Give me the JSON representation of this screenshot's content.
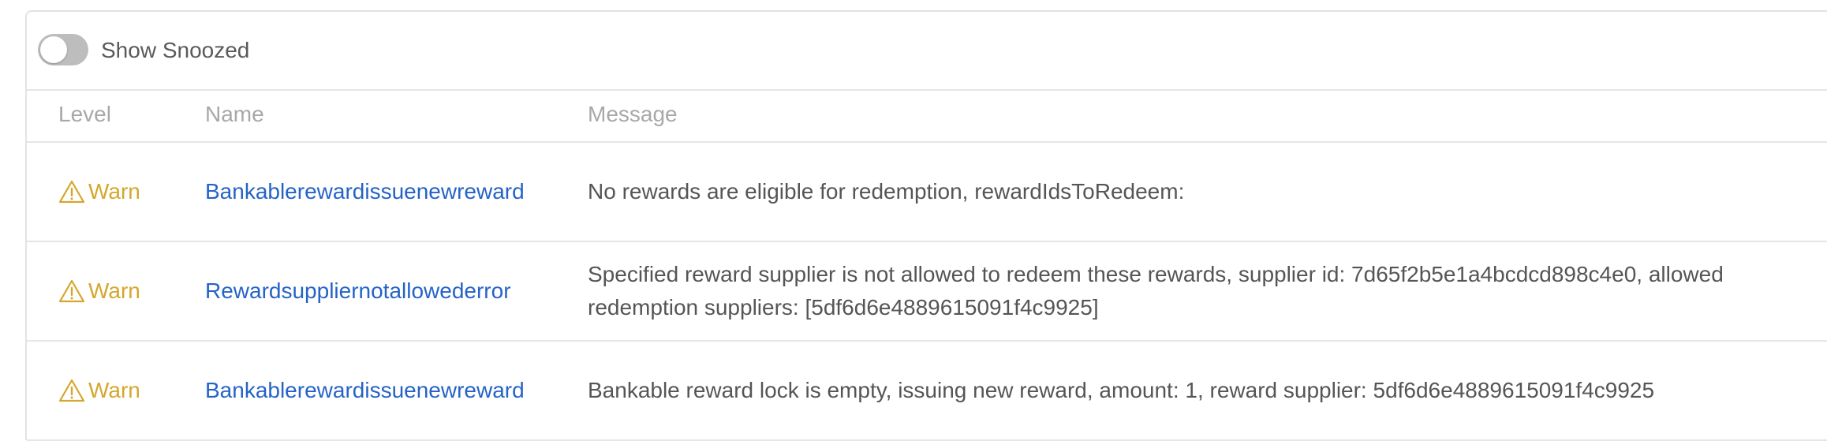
{
  "toolbar": {
    "toggle_label": "Show Snoozed",
    "toggle_state": "off"
  },
  "table": {
    "headers": {
      "level": "Level",
      "name": "Name",
      "message": "Message"
    },
    "rows": [
      {
        "level": "Warn",
        "level_icon": "warning-triangle-icon",
        "name": "Bankablerewardissuenewreward",
        "message": "No rewards are eligible for redemption, rewardIdsToRedeem:"
      },
      {
        "level": "Warn",
        "level_icon": "warning-triangle-icon",
        "name": "Rewardsuppliernotallowederror",
        "message": "Specified reward supplier is not allowed to redeem these rewards, supplier id: 7d65f2b5e1a4bcdcd898c4e0, allowed redemption suppliers: [5df6d6e4889615091f4c9925]"
      },
      {
        "level": "Warn",
        "level_icon": "warning-triangle-icon",
        "name": "Bankablerewardissuenewreward",
        "message": "Bankable reward lock is empty, issuing new reward, amount: 1, reward supplier: 5df6d6e4889615091f4c9925"
      }
    ]
  },
  "colors": {
    "warn": "#d4a72c",
    "link": "#2563c7",
    "header_text": "#a8a8a8",
    "toggle_off": "#bdbdbd"
  }
}
